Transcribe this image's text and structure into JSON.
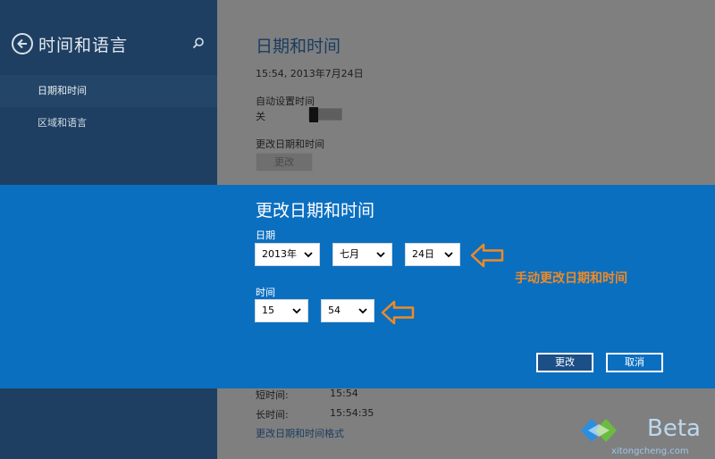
{
  "sidebar": {
    "title": "时间和语言",
    "items": [
      {
        "label": "日期和时间",
        "active": true
      },
      {
        "label": "区域和语言",
        "active": false
      }
    ]
  },
  "main": {
    "title": "日期和时间",
    "current_datetime": "15:54, 2013年7月24日",
    "auto_set_label": "自动设置时间",
    "auto_set_state": "关",
    "change_label": "更改日期和时间",
    "change_button": "更改",
    "short_time_label": "短时间:",
    "short_time_value": "15:54",
    "long_time_label": "长时间:",
    "long_time_value": "15:54:35",
    "format_link": "更改日期和时间格式"
  },
  "dialog": {
    "title": "更改日期和时间",
    "date_label": "日期",
    "year": "2013年",
    "month": "七月",
    "day": "24日",
    "time_label": "时间",
    "hour": "15",
    "minute": "54",
    "ok_button": "更改",
    "cancel_button": "取消"
  },
  "annotation": "手动更改日期和时间",
  "watermark": {
    "text": "Beta",
    "sub": "xitongcheng.com"
  },
  "colors": {
    "dialog_bg": "#0b6fc0",
    "sidebar_bg": "#1e3f62",
    "dim_bg": "#7f7f7f",
    "annotation": "#f08a24"
  }
}
